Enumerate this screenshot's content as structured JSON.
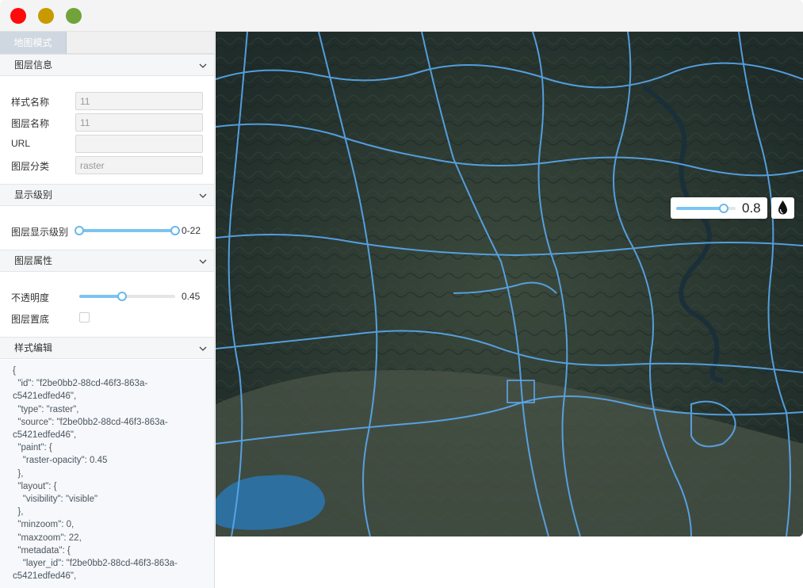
{
  "window": {
    "lights": [
      {
        "name": "close",
        "color": "#ff0b0b"
      },
      {
        "name": "minimize",
        "color": "#c79a00"
      },
      {
        "name": "maximize",
        "color": "#71a33a"
      }
    ]
  },
  "panel": {
    "tab_label": "地图模式",
    "layer_info": {
      "title": "图层信息",
      "fields": [
        {
          "label": "样式名称",
          "value": "11"
        },
        {
          "label": "图层名称",
          "value": "11"
        },
        {
          "label": "URL",
          "value": ""
        },
        {
          "label": "图层分类",
          "value": "raster"
        }
      ]
    },
    "display_level": {
      "title": "显示级别",
      "label": "图层显示级别",
      "min": 0,
      "max": 22,
      "value_text": "0-22"
    },
    "layer_props": {
      "title": "图层属性",
      "opacity_label": "不透明度",
      "opacity_value": 0.45,
      "opacity_text": "0.45",
      "bottom_label": "图层置底",
      "bottom_checked": false
    },
    "style_edit": {
      "title": "样式编辑",
      "lines": [
        "{",
        "  \"id\": \"f2be0bb2-88cd-46f3-863a-",
        "c5421edfed46\",",
        "  \"type\": \"raster\",",
        "  \"source\": \"f2be0bb2-88cd-46f3-863a-",
        "c5421edfed46\",",
        "  \"paint\": {",
        "    \"raster-opacity\": 0.45",
        "  },",
        "  \"layout\": {",
        "    \"visibility\": \"visible\"",
        "  },",
        "  \"minzoom\": 0,",
        "  \"maxzoom\": 22,",
        "  \"metadata\": {",
        "    \"layer_id\": \"f2be0bb2-88cd-46f3-863a-",
        "c5421edfed46\","
      ]
    }
  },
  "map": {
    "opacity_value": 0.8,
    "opacity_text": "0.8",
    "colors": {
      "road": "#5aa9ef",
      "water": "#2d6f9e",
      "accent": "#7cc4f0"
    }
  }
}
